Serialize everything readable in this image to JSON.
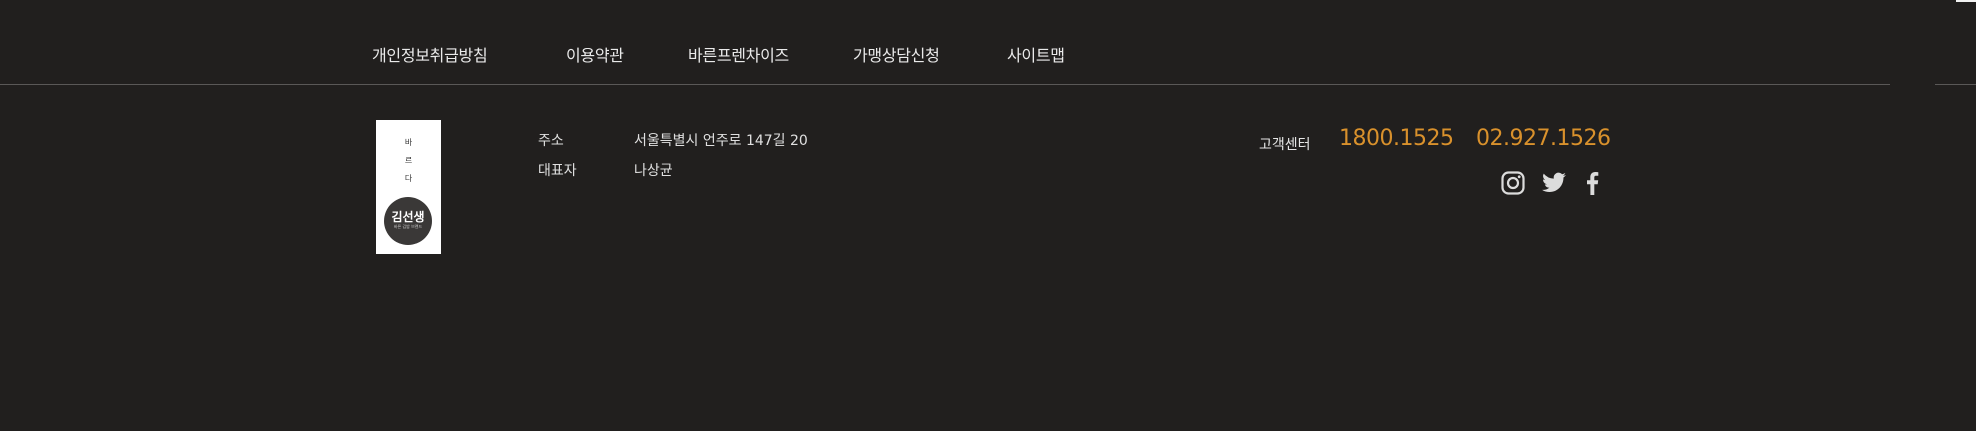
{
  "nav": {
    "items": [
      {
        "label": "개인정보취급방침"
      },
      {
        "label": "이용약관"
      },
      {
        "label": "바른프렌차이즈"
      },
      {
        "label": "가맹상담신청"
      },
      {
        "label": "사이트맵"
      }
    ]
  },
  "logo": {
    "vertical_text": [
      "바",
      "르",
      "다"
    ],
    "name": "김선생",
    "tagline": "바른 김밥 브랜드"
  },
  "company": {
    "address_label": "주소",
    "address_value": "서울특별시 언주로 147길 20",
    "ceo_label": "대표자",
    "ceo_value": "나상균"
  },
  "customer_center": {
    "label": "고객센터",
    "phone1": "1800.1525",
    "phone2": "02.927.1526",
    "accent_color": "#d9912c"
  },
  "social": {
    "icons": [
      "instagram-icon",
      "twitter-icon",
      "facebook-icon"
    ]
  }
}
